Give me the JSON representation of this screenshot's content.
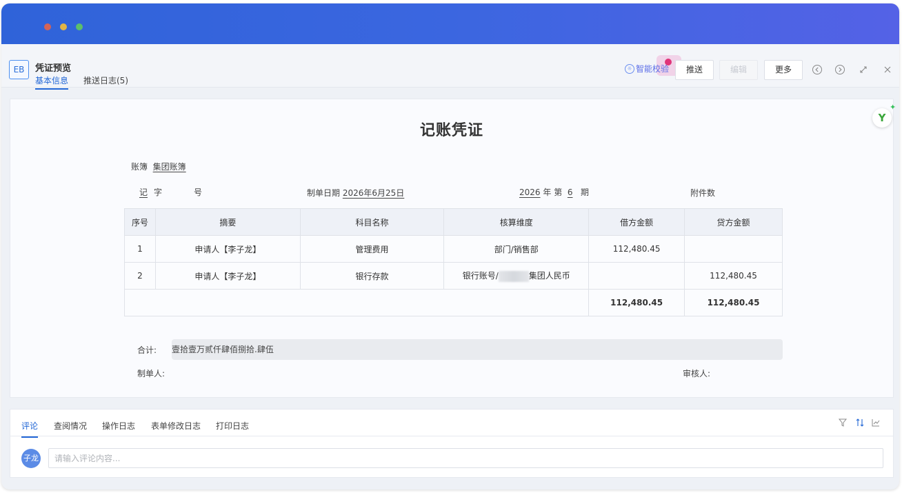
{
  "header": {
    "badge": "EB",
    "title": "凭证预览",
    "tabs": [
      {
        "label": "基本信息",
        "active": true
      },
      {
        "label": "推送日志(5)",
        "active": false
      }
    ],
    "smart_check": "智能校验",
    "buttons": {
      "push": "推送",
      "edit": "编辑",
      "more": "更多"
    }
  },
  "voucher": {
    "title": "记账凭证",
    "ledger_label": "账簿",
    "ledger_value": "集团账簿",
    "ji": "记",
    "zi": "字",
    "hao": "号",
    "date_label": "制单日期",
    "date_value": "2026年6月25日",
    "year": "2026",
    "year_label": "年 第",
    "period": "6",
    "period_label": "期",
    "attachment_label": "附件数",
    "columns": [
      "序号",
      "摘要",
      "科目名称",
      "核算维度",
      "借方金额",
      "贷方金额"
    ],
    "rows": [
      {
        "no": "1",
        "summary": "申请人【李子龙】",
        "account": "管理费用",
        "dimension_pre": "部门/销售部",
        "dimension_post": "",
        "debit": "112,480.45",
        "credit": ""
      },
      {
        "no": "2",
        "summary": "申请人【李子龙】",
        "account": "银行存款",
        "dimension_pre": "银行账号/",
        "dimension_post": "集团人民币",
        "debit": "",
        "credit": "112,480.45"
      }
    ],
    "total_debit": "112,480.45",
    "total_credit": "112,480.45",
    "sum_label": "合计:",
    "sum_text": "壹拾壹万贰仟肆佰捌拾.肆伍",
    "maker_label": "制单人:",
    "reviewer_label": "审核人:"
  },
  "bottom": {
    "tabs": [
      {
        "label": "评论",
        "active": true
      },
      {
        "label": "查阅情况",
        "active": false
      },
      {
        "label": "操作日志",
        "active": false
      },
      {
        "label": "表单修改日志",
        "active": false
      },
      {
        "label": "打印日志",
        "active": false
      }
    ],
    "avatar": "子龙",
    "comment_placeholder": "请输入评论内容..."
  },
  "colors": {
    "accent": "#2166d6",
    "titlebar_start": "#2f63d9",
    "titlebar_end": "#5462e6"
  }
}
